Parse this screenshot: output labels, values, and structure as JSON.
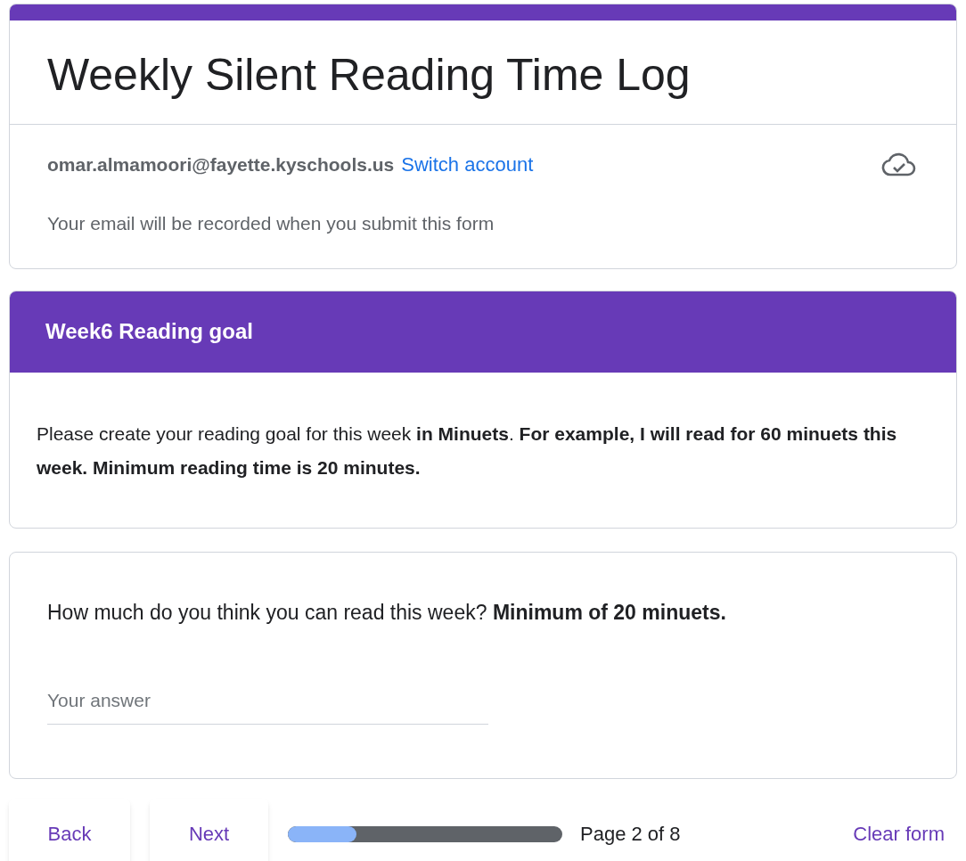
{
  "form": {
    "title": "Weekly Silent Reading Time Log",
    "account": {
      "email": "omar.almamoori@fayette.kyschools.us",
      "switch_link": "Switch account",
      "note": "Your email will be recorded when you submit this form"
    }
  },
  "section": {
    "title": "Week6 Reading goal",
    "description": "Please create your reading goal for this week **in Minuets**. **For example, I will read for 60 minuets this week. Minimum reading time is 20 minutes.**"
  },
  "question": {
    "text": "How much do you think you can read this week? **Minimum of 20 minuets.**",
    "answer": {
      "placeholder": "Your answer"
    }
  },
  "navigation": {
    "buttons": [
      "Back",
      "Next"
    ],
    "progress": {
      "level": 0.25,
      "label": "Page 2 of 8"
    },
    "clear": "Clear form"
  }
}
